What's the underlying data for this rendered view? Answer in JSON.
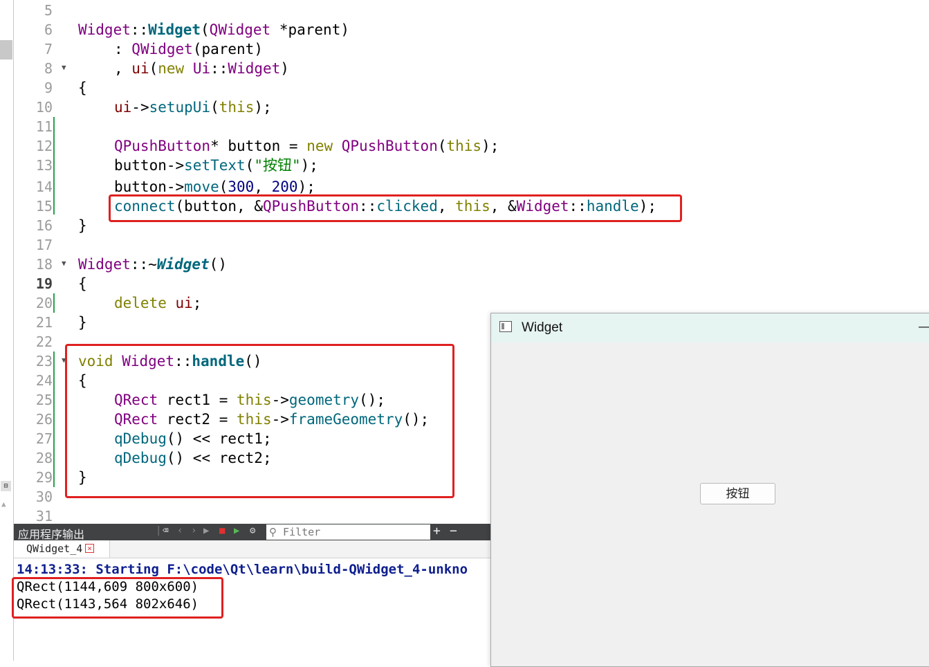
{
  "editor": {
    "line_numbers": [
      "5",
      "6",
      "7",
      "8",
      "9",
      "10",
      "11",
      "12",
      "13",
      "14",
      "15",
      "16",
      "17",
      "18",
      "19",
      "20",
      "21",
      "22",
      "23",
      "24",
      "25",
      "26",
      "27",
      "28",
      "29",
      "30",
      "31"
    ],
    "lines": {
      "l6": [
        "Widget",
        "::",
        "Widget",
        "(",
        "QWidget",
        " *",
        "parent",
        ")"
      ],
      "l7": [
        ":",
        " QWidget",
        "(",
        "parent",
        ")"
      ],
      "l8": [
        ",",
        " ui",
        "(",
        "new",
        " Ui",
        "::",
        "Widget",
        ")"
      ],
      "l9": "{",
      "l10": [
        "ui",
        "->",
        "setupUi",
        "(",
        "this",
        ");"
      ],
      "l12": [
        "QPushButton",
        "*",
        " button",
        " = ",
        "new",
        " QPushButton",
        "(",
        "this",
        ");"
      ],
      "l13": [
        "button",
        "->",
        "setText",
        "(",
        "\"按钮\"",
        ");"
      ],
      "l14": [
        "button",
        "->",
        "move",
        "(",
        "300",
        ", ",
        "200",
        ");"
      ],
      "l15": [
        "connect",
        "(",
        "button",
        ", &",
        "QPushButton",
        "::",
        "clicked",
        ", ",
        "this",
        ", &",
        "Widget",
        "::",
        "handle",
        ");"
      ],
      "l16": "}",
      "l18": [
        "Widget",
        "::",
        "~",
        "Widget",
        "()"
      ],
      "l19": "{",
      "l20": [
        "delete",
        " ui",
        ";"
      ],
      "l21": "}",
      "l23": [
        "void",
        " Widget",
        "::",
        "handle",
        "()"
      ],
      "l24": "{",
      "l25": [
        "QRect",
        " rect1",
        " = ",
        "this",
        "->",
        "geometry",
        "();"
      ],
      "l26": [
        "QRect",
        " rect2",
        " = ",
        "this",
        "->",
        "frameGeometry",
        "();"
      ],
      "l27": [
        "qDebug",
        "()",
        " << ",
        "rect1",
        ";"
      ],
      "l28": [
        "qDebug",
        "()",
        " << ",
        "rect2",
        ";"
      ],
      "l29": "}"
    }
  },
  "output_pane": {
    "title": "应用程序输出",
    "filter_placeholder": "Filter",
    "tab_label": "QWidget_4",
    "tab_close": "×",
    "add_button": "+",
    "remove_button": "−",
    "lines": {
      "start": "14:13:33: Starting F:\\code\\Qt\\learn\\build-QWidget_4-unkno",
      "rect1": "QRect(1144,609 800x600)",
      "rect2": "QRect(1143,564 802x646)"
    }
  },
  "widget_window": {
    "title": "Widget",
    "minimize": "—",
    "button_label": "按钮"
  },
  "colors": {
    "highlight_box": "#e02020",
    "toolbar_bg": "#404244",
    "titlebar_bg": "#e6f4f2"
  }
}
